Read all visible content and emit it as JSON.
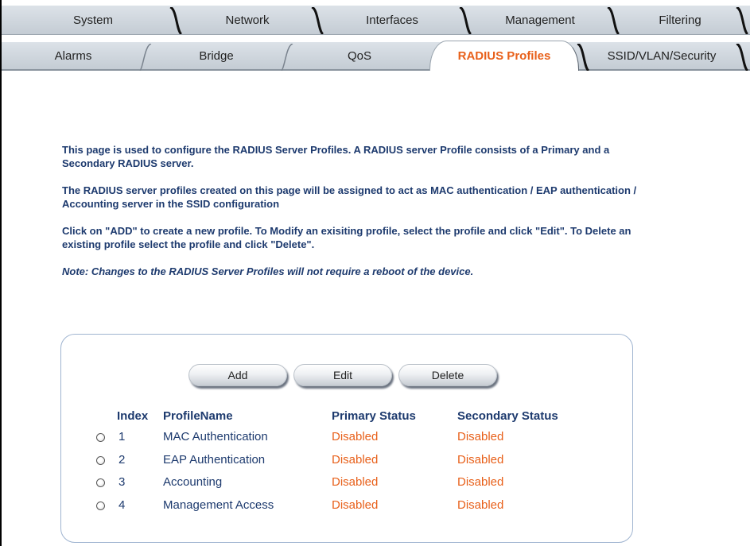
{
  "tabs_row1": [
    {
      "label": "System",
      "active": false
    },
    {
      "label": "Network",
      "active": false
    },
    {
      "label": "Interfaces",
      "active": false
    },
    {
      "label": "Management",
      "active": false
    },
    {
      "label": "Filtering",
      "active": false
    }
  ],
  "tabs_row2": [
    {
      "label": "Alarms",
      "active": false
    },
    {
      "label": "Bridge",
      "active": false
    },
    {
      "label": "QoS",
      "active": false
    },
    {
      "label": "RADIUS Profiles",
      "active": true
    },
    {
      "label": "SSID/VLAN/Security",
      "active": false
    }
  ],
  "intro": {
    "p1": "This page is used to configure the RADIUS Server Profiles. A RADIUS server Profile consists of a Primary and a Secondary RADIUS server.",
    "p2": "The RADIUS server profiles created on this page will be assigned to act as MAC authentication / EAP authentication / Accounting server in the SSID configuration",
    "p3": "Click on \"ADD\" to create a new profile. To Modify an exisiting profile, select the profile and click \"Edit\". To Delete an existing profile select the profile and click \"Delete\".",
    "note": "Note: Changes to the RADIUS Server Profiles will not require a reboot of the device."
  },
  "buttons": {
    "add": "Add",
    "edit": "Edit",
    "delete": "Delete"
  },
  "table": {
    "headers": {
      "index": "Index",
      "name": "ProfileName",
      "primary": "Primary Status",
      "secondary": "Secondary Status"
    },
    "rows": [
      {
        "index": "1",
        "name": "MAC Authentication",
        "primary": "Disabled",
        "secondary": "Disabled"
      },
      {
        "index": "2",
        "name": "EAP Authentication",
        "primary": "Disabled",
        "secondary": "Disabled"
      },
      {
        "index": "3",
        "name": "Accounting",
        "primary": "Disabled",
        "secondary": "Disabled"
      },
      {
        "index": "4",
        "name": "Management Access",
        "primary": "Disabled",
        "secondary": "Disabled"
      }
    ]
  },
  "colors": {
    "accent": "#e8601a",
    "text": "#1d3a6e",
    "tab_bg": "#cfd6dd"
  }
}
